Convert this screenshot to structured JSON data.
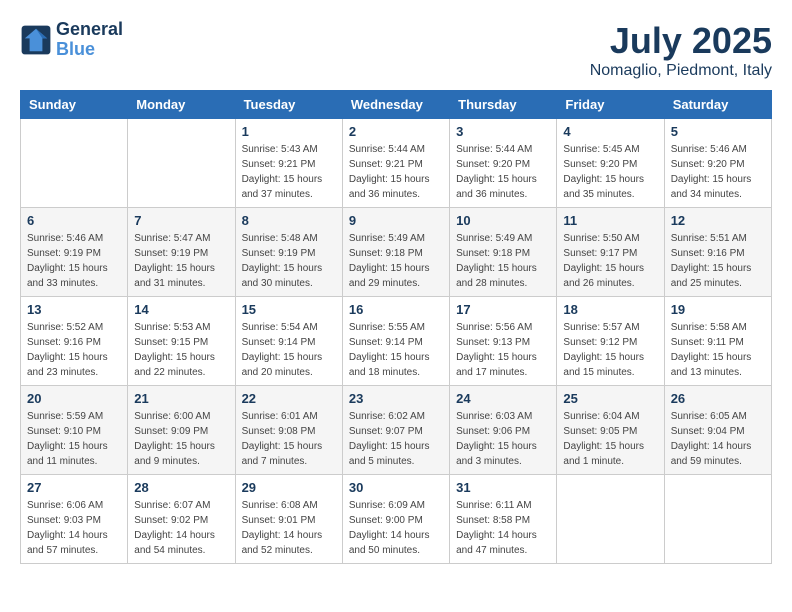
{
  "logo": {
    "line1": "General",
    "line2": "Blue"
  },
  "title": "July 2025",
  "location": "Nomaglio, Piedmont, Italy",
  "weekdays": [
    "Sunday",
    "Monday",
    "Tuesday",
    "Wednesday",
    "Thursday",
    "Friday",
    "Saturday"
  ],
  "weeks": [
    [
      {
        "day": "",
        "info": ""
      },
      {
        "day": "",
        "info": ""
      },
      {
        "day": "1",
        "info": "Sunrise: 5:43 AM\nSunset: 9:21 PM\nDaylight: 15 hours\nand 37 minutes."
      },
      {
        "day": "2",
        "info": "Sunrise: 5:44 AM\nSunset: 9:21 PM\nDaylight: 15 hours\nand 36 minutes."
      },
      {
        "day": "3",
        "info": "Sunrise: 5:44 AM\nSunset: 9:20 PM\nDaylight: 15 hours\nand 36 minutes."
      },
      {
        "day": "4",
        "info": "Sunrise: 5:45 AM\nSunset: 9:20 PM\nDaylight: 15 hours\nand 35 minutes."
      },
      {
        "day": "5",
        "info": "Sunrise: 5:46 AM\nSunset: 9:20 PM\nDaylight: 15 hours\nand 34 minutes."
      }
    ],
    [
      {
        "day": "6",
        "info": "Sunrise: 5:46 AM\nSunset: 9:19 PM\nDaylight: 15 hours\nand 33 minutes."
      },
      {
        "day": "7",
        "info": "Sunrise: 5:47 AM\nSunset: 9:19 PM\nDaylight: 15 hours\nand 31 minutes."
      },
      {
        "day": "8",
        "info": "Sunrise: 5:48 AM\nSunset: 9:19 PM\nDaylight: 15 hours\nand 30 minutes."
      },
      {
        "day": "9",
        "info": "Sunrise: 5:49 AM\nSunset: 9:18 PM\nDaylight: 15 hours\nand 29 minutes."
      },
      {
        "day": "10",
        "info": "Sunrise: 5:49 AM\nSunset: 9:18 PM\nDaylight: 15 hours\nand 28 minutes."
      },
      {
        "day": "11",
        "info": "Sunrise: 5:50 AM\nSunset: 9:17 PM\nDaylight: 15 hours\nand 26 minutes."
      },
      {
        "day": "12",
        "info": "Sunrise: 5:51 AM\nSunset: 9:16 PM\nDaylight: 15 hours\nand 25 minutes."
      }
    ],
    [
      {
        "day": "13",
        "info": "Sunrise: 5:52 AM\nSunset: 9:16 PM\nDaylight: 15 hours\nand 23 minutes."
      },
      {
        "day": "14",
        "info": "Sunrise: 5:53 AM\nSunset: 9:15 PM\nDaylight: 15 hours\nand 22 minutes."
      },
      {
        "day": "15",
        "info": "Sunrise: 5:54 AM\nSunset: 9:14 PM\nDaylight: 15 hours\nand 20 minutes."
      },
      {
        "day": "16",
        "info": "Sunrise: 5:55 AM\nSunset: 9:14 PM\nDaylight: 15 hours\nand 18 minutes."
      },
      {
        "day": "17",
        "info": "Sunrise: 5:56 AM\nSunset: 9:13 PM\nDaylight: 15 hours\nand 17 minutes."
      },
      {
        "day": "18",
        "info": "Sunrise: 5:57 AM\nSunset: 9:12 PM\nDaylight: 15 hours\nand 15 minutes."
      },
      {
        "day": "19",
        "info": "Sunrise: 5:58 AM\nSunset: 9:11 PM\nDaylight: 15 hours\nand 13 minutes."
      }
    ],
    [
      {
        "day": "20",
        "info": "Sunrise: 5:59 AM\nSunset: 9:10 PM\nDaylight: 15 hours\nand 11 minutes."
      },
      {
        "day": "21",
        "info": "Sunrise: 6:00 AM\nSunset: 9:09 PM\nDaylight: 15 hours\nand 9 minutes."
      },
      {
        "day": "22",
        "info": "Sunrise: 6:01 AM\nSunset: 9:08 PM\nDaylight: 15 hours\nand 7 minutes."
      },
      {
        "day": "23",
        "info": "Sunrise: 6:02 AM\nSunset: 9:07 PM\nDaylight: 15 hours\nand 5 minutes."
      },
      {
        "day": "24",
        "info": "Sunrise: 6:03 AM\nSunset: 9:06 PM\nDaylight: 15 hours\nand 3 minutes."
      },
      {
        "day": "25",
        "info": "Sunrise: 6:04 AM\nSunset: 9:05 PM\nDaylight: 15 hours\nand 1 minute."
      },
      {
        "day": "26",
        "info": "Sunrise: 6:05 AM\nSunset: 9:04 PM\nDaylight: 14 hours\nand 59 minutes."
      }
    ],
    [
      {
        "day": "27",
        "info": "Sunrise: 6:06 AM\nSunset: 9:03 PM\nDaylight: 14 hours\nand 57 minutes."
      },
      {
        "day": "28",
        "info": "Sunrise: 6:07 AM\nSunset: 9:02 PM\nDaylight: 14 hours\nand 54 minutes."
      },
      {
        "day": "29",
        "info": "Sunrise: 6:08 AM\nSunset: 9:01 PM\nDaylight: 14 hours\nand 52 minutes."
      },
      {
        "day": "30",
        "info": "Sunrise: 6:09 AM\nSunset: 9:00 PM\nDaylight: 14 hours\nand 50 minutes."
      },
      {
        "day": "31",
        "info": "Sunrise: 6:11 AM\nSunset: 8:58 PM\nDaylight: 14 hours\nand 47 minutes."
      },
      {
        "day": "",
        "info": ""
      },
      {
        "day": "",
        "info": ""
      }
    ]
  ]
}
